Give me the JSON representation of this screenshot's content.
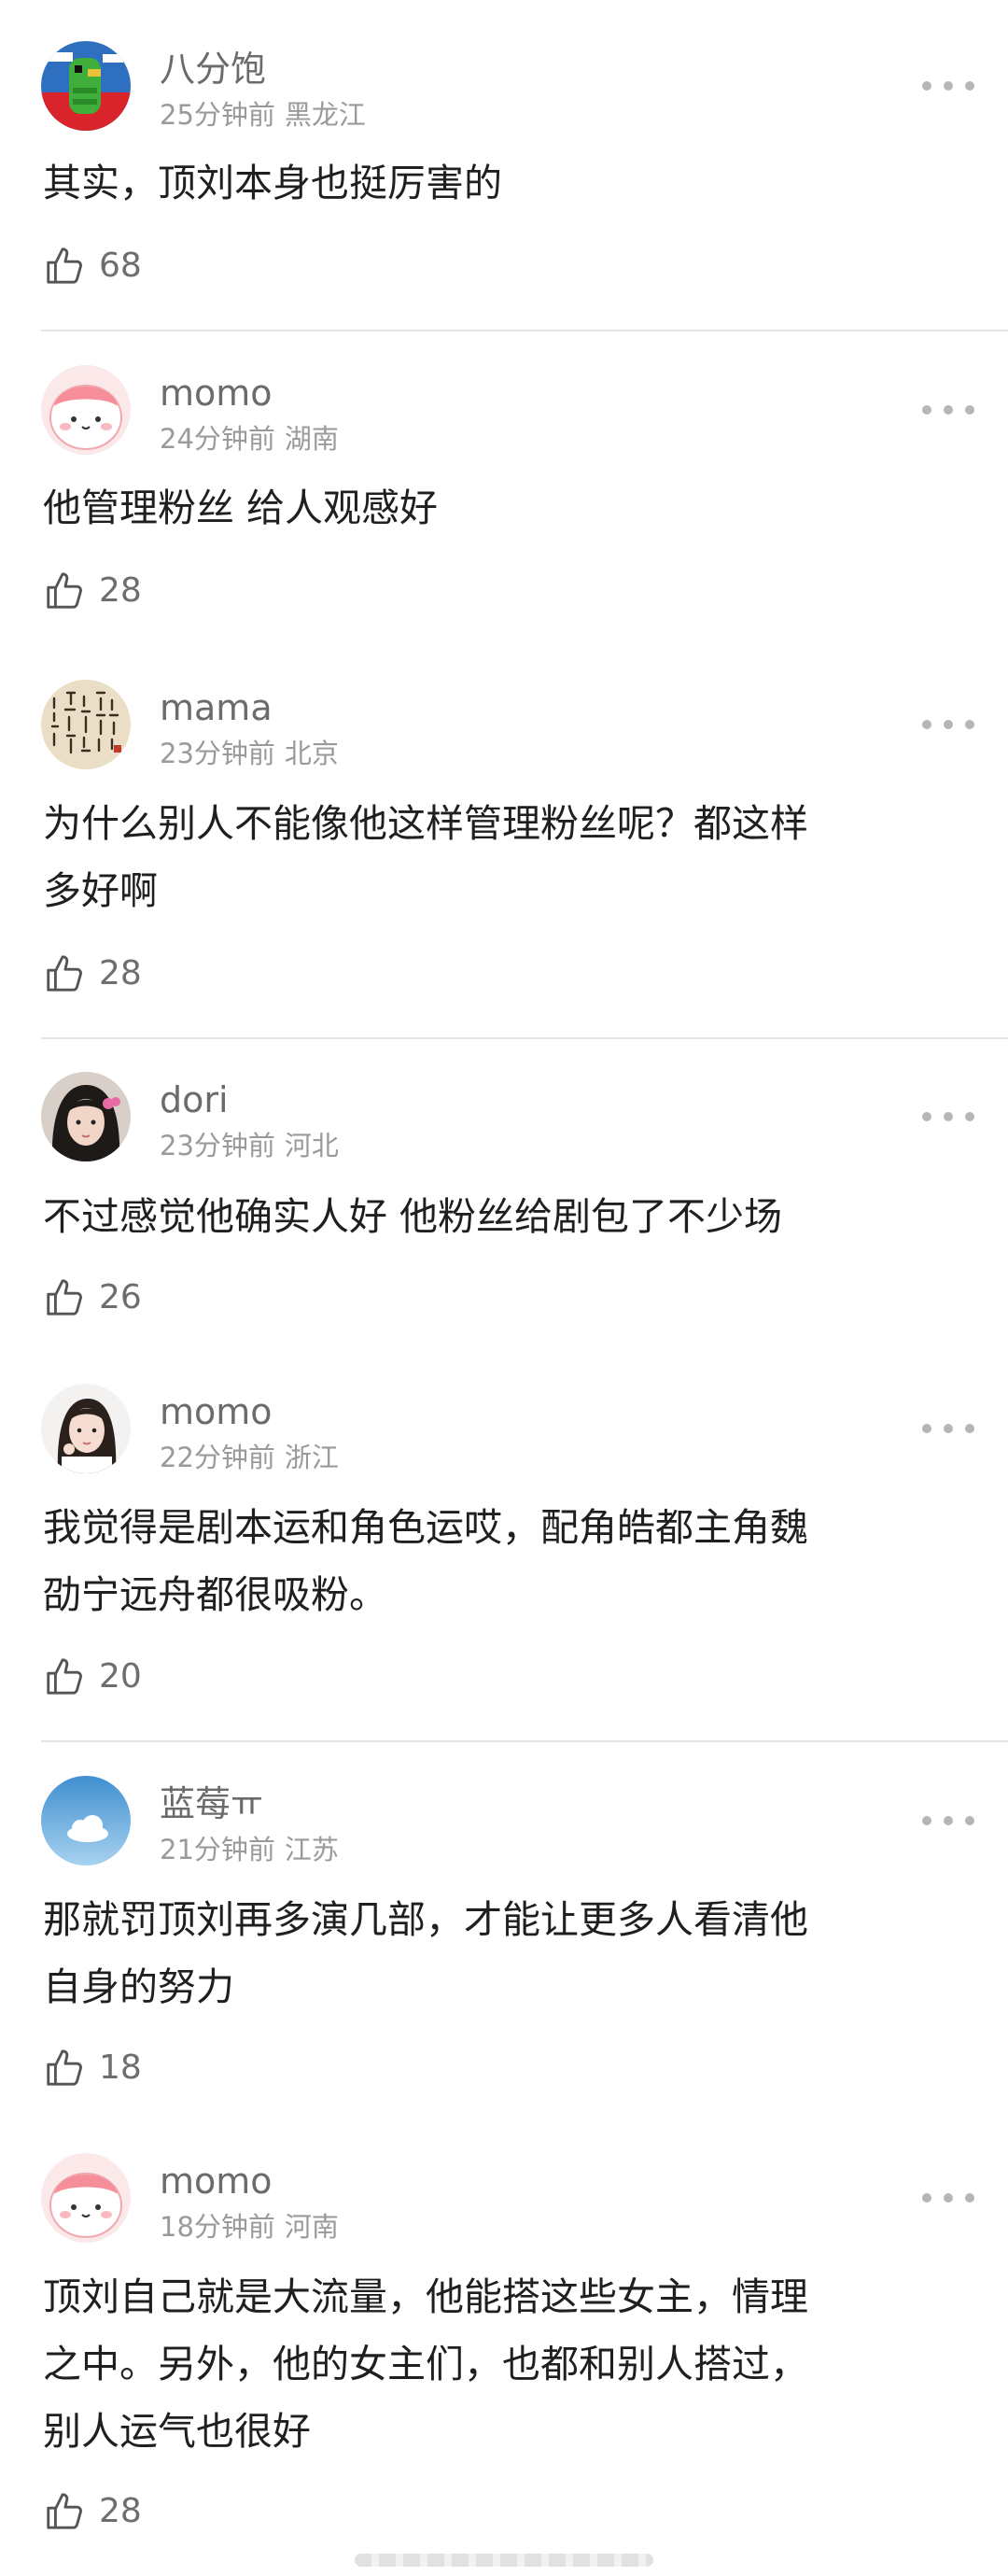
{
  "comments": [
    {
      "user": "八分饱",
      "time": "25分钟前",
      "location": "黑龙江",
      "lines": [
        "其实，顶刘本身也挺厉害的"
      ],
      "likes": "68",
      "avatar_icon": "pixel-parrot-avatar"
    },
    {
      "user": "momo",
      "time": "24分钟前",
      "location": "湖南",
      "lines": [
        "他管理粉丝 给人观感好"
      ],
      "likes": "28",
      "avatar_icon": "pink-peach-avatar"
    },
    {
      "user": "mama",
      "time": "23分钟前",
      "location": "北京",
      "lines": [
        "为什么别人不能像他这样管理粉丝呢？都这样",
        "多好啊"
      ],
      "likes": "28",
      "avatar_icon": "calligraphy-avatar"
    },
    {
      "user": "dori",
      "time": "23分钟前",
      "location": "河北",
      "lines": [
        "不过感觉他确实人好 他粉丝给剧包了不少场"
      ],
      "likes": "26",
      "avatar_icon": "girl-photo-avatar"
    },
    {
      "user": "momo",
      "time": "22分钟前",
      "location": "浙江",
      "lines": [
        "我觉得是剧本运和角色运哎，配角皓都主角魏",
        "劭宁远舟都很吸粉。"
      ],
      "likes": "20",
      "avatar_icon": "girl-portrait-avatar"
    },
    {
      "user": "蓝莓ㅠ",
      "time": "21分钟前",
      "location": "江苏",
      "lines": [
        "那就罚顶刘再多演几部，才能让更多人看清他",
        "自身的努力"
      ],
      "likes": "18",
      "avatar_icon": "blue-sky-cloud-avatar"
    },
    {
      "user": "momo",
      "time": "18分钟前",
      "location": "河南",
      "lines": [
        "顶刘自己就是大流量，他能搭这些女主，情理",
        "之中。另外，他的女主们，也都和别人搭过，",
        "别人运气也很好"
      ],
      "likes": "28",
      "avatar_icon": "pink-peach-avatar"
    }
  ],
  "icons": {
    "like": "thumbs-up-icon",
    "more": "more-dots-icon"
  },
  "colors": {
    "username": "#6b6b6b",
    "meta": "#9a9a9a",
    "text": "#1f1f1f",
    "divider": "#e4e4e4"
  }
}
